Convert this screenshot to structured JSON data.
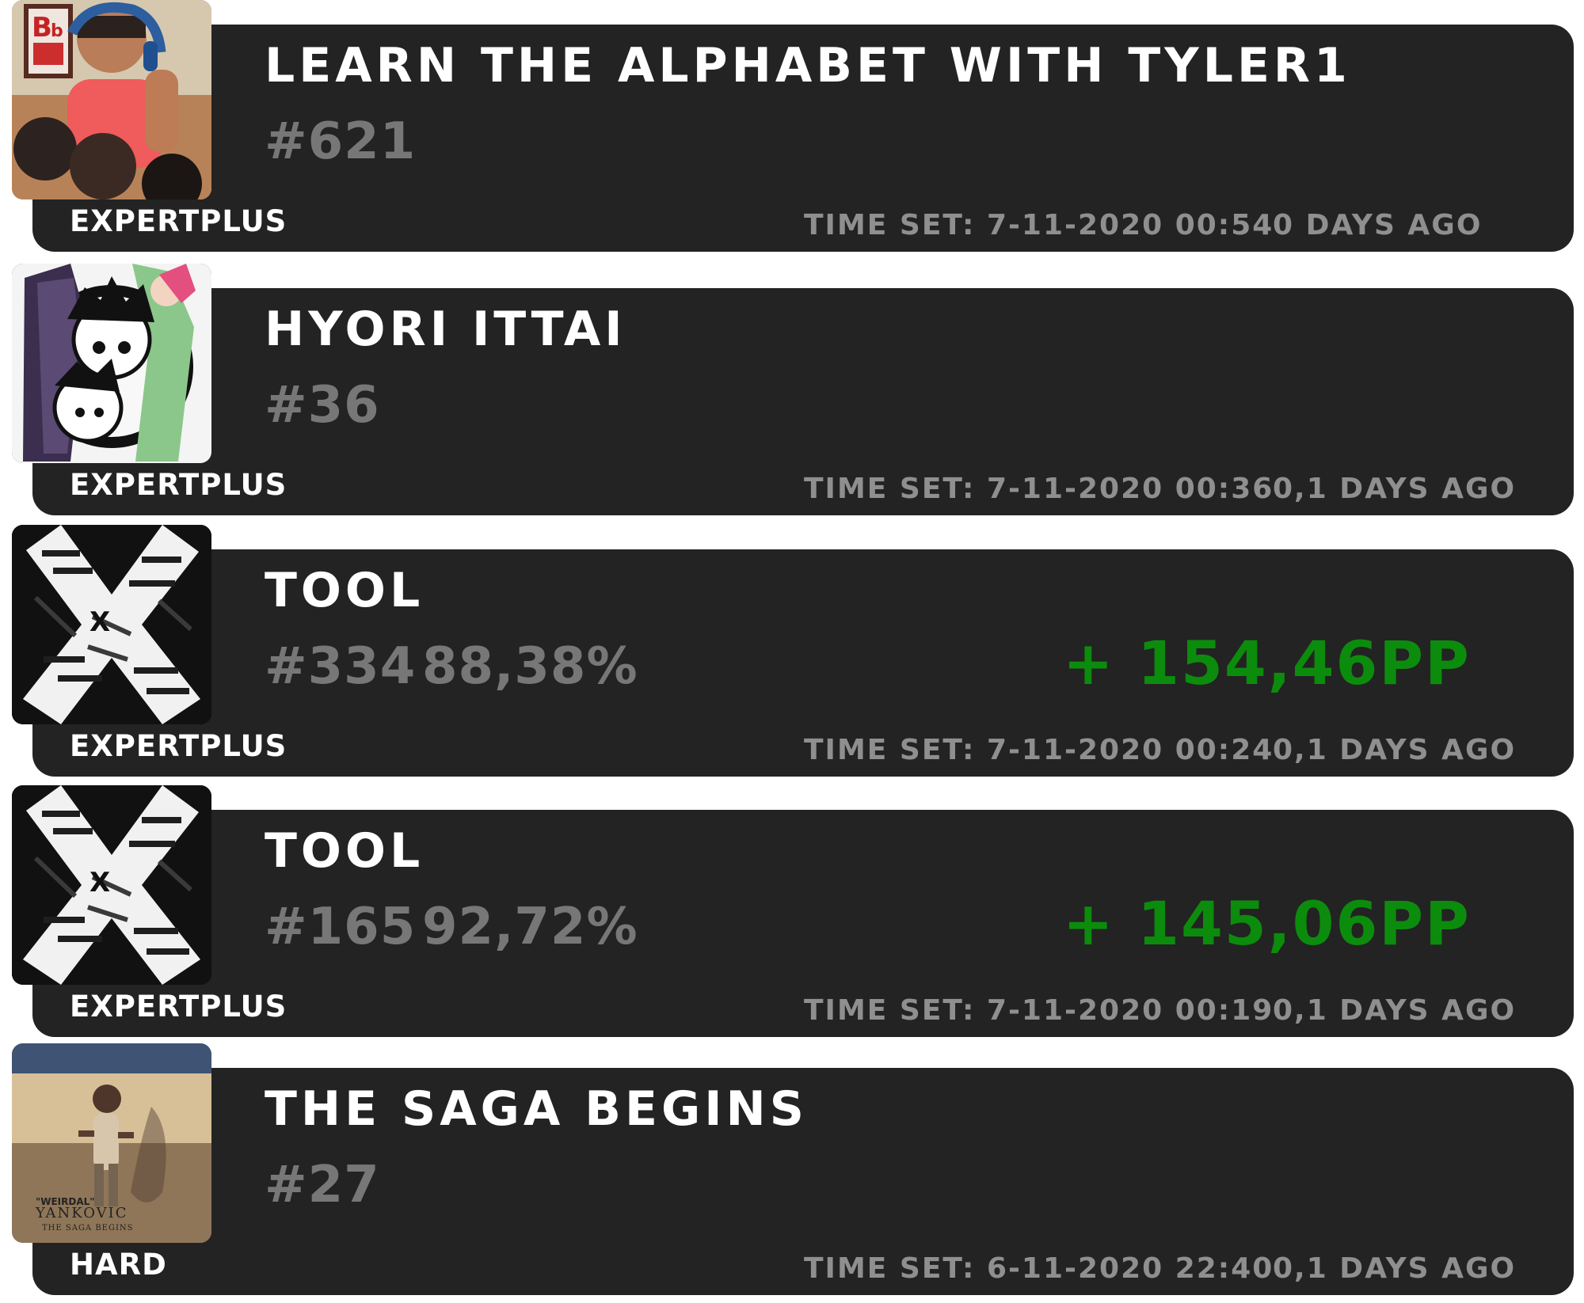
{
  "scores": [
    {
      "song_title": "LEARN THE ALPHABET WITH TYLER1",
      "rank": "#621",
      "accuracy": "",
      "pp": "",
      "difficulty": "EXPERTPLUS",
      "time_set": "TIME SET: 7-11-2020 00:54",
      "time_ago": "0 DAYS AGO",
      "cover_icon": "tyler1-alphabet-cover"
    },
    {
      "song_title": "HYORI ITTAI",
      "rank": "#36",
      "accuracy": "",
      "pp": "",
      "difficulty": "EXPERTPLUS",
      "time_set": "TIME SET: 7-11-2020 00:36",
      "time_ago": "0,1 DAYS AGO",
      "cover_icon": "anime-characters-cover"
    },
    {
      "song_title": "TOOL",
      "rank": "#334",
      "accuracy": "88,38%",
      "pp": "+ 154,46PP",
      "difficulty": "EXPERTPLUS",
      "time_set": "TIME SET: 7-11-2020 00:24",
      "time_ago": "0,1 DAYS AGO",
      "cover_icon": "x-typography-cover"
    },
    {
      "song_title": "TOOL",
      "rank": "#165",
      "accuracy": "92,72%",
      "pp": "+ 145,06PP",
      "difficulty": "EXPERTPLUS",
      "time_set": "TIME SET: 7-11-2020 00:19",
      "time_ago": "0,1 DAYS AGO",
      "cover_icon": "x-typography-cover"
    },
    {
      "song_title": "THE SAGA BEGINS",
      "rank": "#27",
      "accuracy": "",
      "pp": "",
      "difficulty": "HARD",
      "time_set": "TIME SET: 6-11-2020 22:40",
      "time_ago": "0,1 DAYS AGO",
      "cover_icon": "saga-begins-cover",
      "cover_text": {
        "line1": "\"WEIRDAL\"",
        "line2": "YANKOVIC",
        "line3": "THE SAGA BEGINS"
      }
    }
  ],
  "colors": {
    "panel_background": "#232323",
    "title_text": "#ffffff",
    "rank_text": "#777777",
    "pp_text": "#0c8c0c",
    "meta_text": "#8f8f8f"
  }
}
